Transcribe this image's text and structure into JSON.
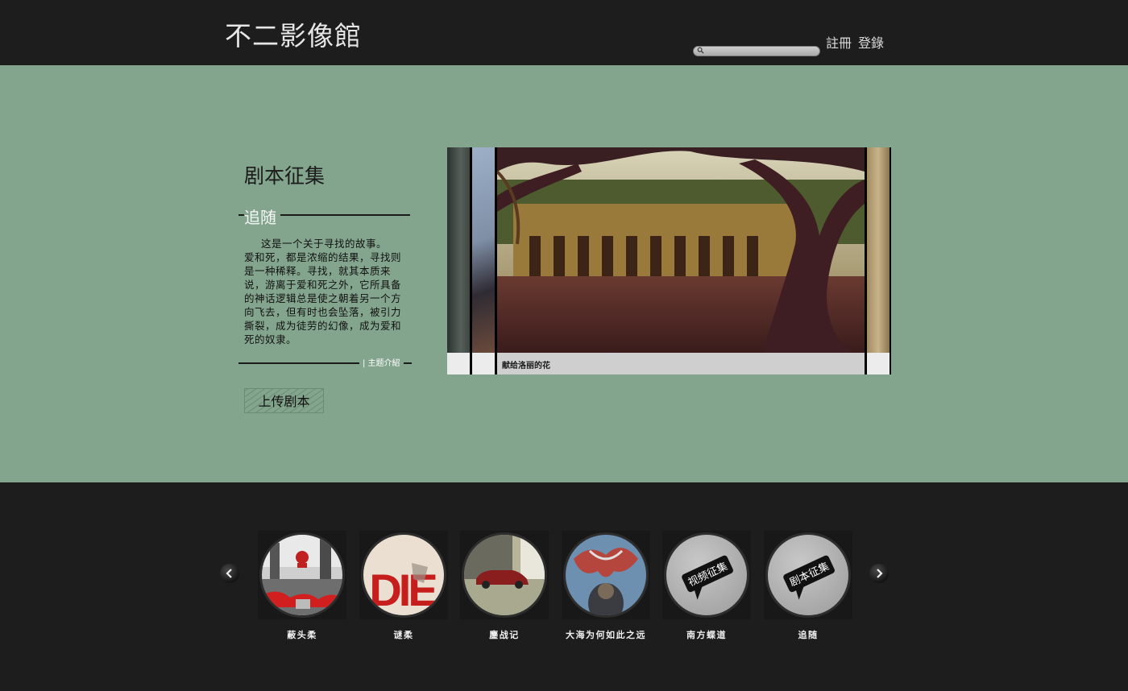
{
  "header": {
    "logo": "不二影像館",
    "register_label": "註冊",
    "login_label": "登錄",
    "search": {
      "placeholder": "",
      "value": ""
    }
  },
  "feature": {
    "title": "剧本征集",
    "subtitle": "追随",
    "description_first": "这是一个关于寻找的故事。",
    "description_rest": "爱和死，都是浓缩的结果，寻找则是一种稀释。寻找，就其本质来说，游离于爱和死之外，它所具备的神话逻辑总是使之朝着另一个方向飞去，但有时也会坠落，被引力撕裂，成为徒劳的幻像，成为爱和死的奴隶。",
    "intro_link": "| 主题介紹",
    "upload_label": "上传剧本"
  },
  "slider": {
    "caption": "献给洛丽的花"
  },
  "carousel": {
    "prev_icon": "chevron-left-icon",
    "next_icon": "chevron-right-icon",
    "items": [
      {
        "label": "蔽头柔"
      },
      {
        "label": "谜柔"
      },
      {
        "label": "鏖战记"
      },
      {
        "label": "大海为何如此之远"
      },
      {
        "label": "南方蝶道",
        "badge": "视频征集"
      },
      {
        "label": "追随",
        "badge": "剧本征集"
      }
    ]
  },
  "colors": {
    "main_bg": "#84a58d",
    "dark_bg": "#1d1d1d"
  }
}
